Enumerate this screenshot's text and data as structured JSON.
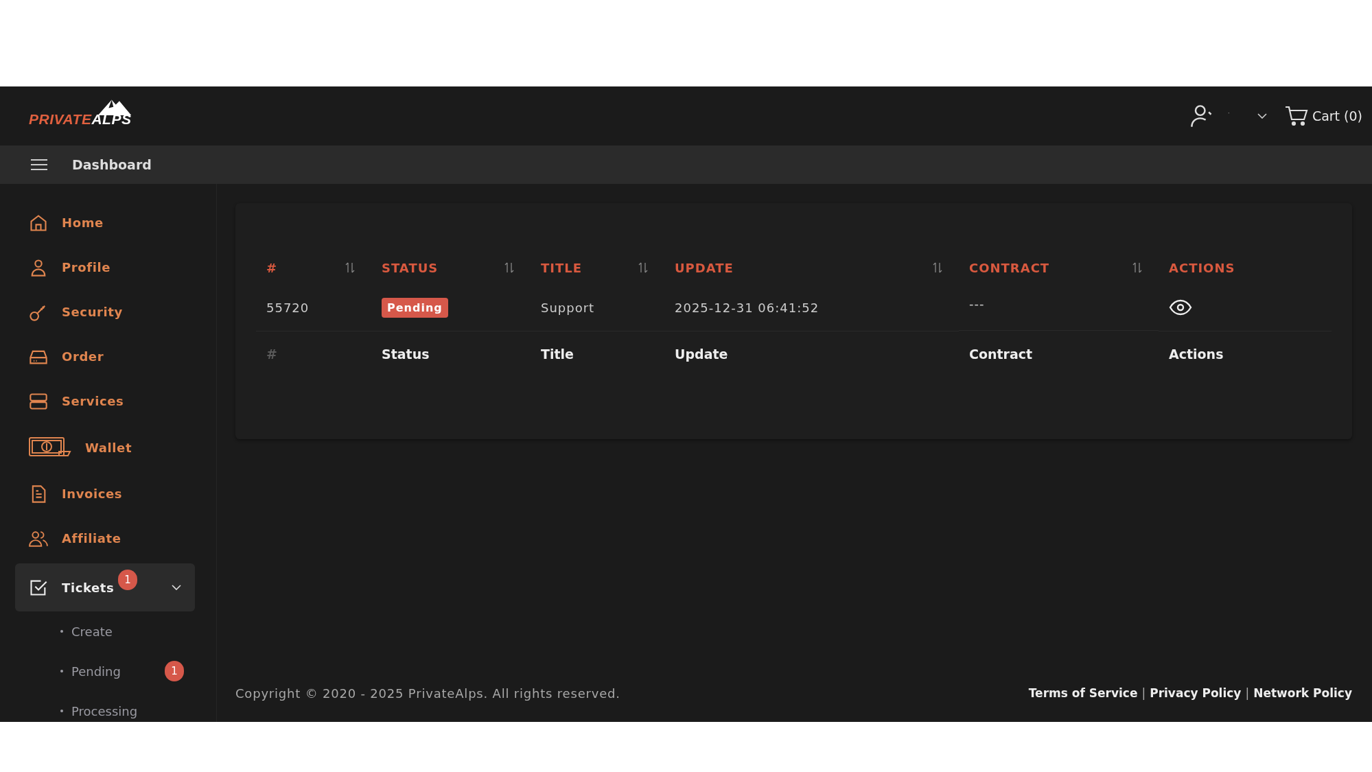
{
  "header": {
    "logo": {
      "part_1": "PRIVATE",
      "part_2": "ALPS"
    },
    "user_name": "·",
    "cart": "Cart (0)"
  },
  "subheader": {
    "title": "Dashboard"
  },
  "sidebar": {
    "items": [
      {
        "label": "Home",
        "selected": false
      },
      {
        "label": "Profile",
        "selected": false
      },
      {
        "label": "Security",
        "selected": false
      },
      {
        "label": "Order",
        "selected": false
      },
      {
        "label": "Services",
        "selected": false
      },
      {
        "label": "Wallet",
        "selected": false
      },
      {
        "label": "Invoices",
        "selected": false
      },
      {
        "label": "Affiliate",
        "selected": false
      },
      {
        "label": "Tickets",
        "selected": true,
        "expanded": true,
        "badge": "1",
        "children": [
          {
            "label": "Create"
          },
          {
            "label": "Pending",
            "badge": "1"
          },
          {
            "label": "Processing"
          }
        ]
      }
    ]
  },
  "table": {
    "columns": [
      {
        "label": "#",
        "sortable": true
      },
      {
        "label": "STATUS",
        "sortable": true
      },
      {
        "label": "TITLE",
        "sortable": true
      },
      {
        "label": "UPDATE",
        "sortable": true
      },
      {
        "label": "CONTRACT",
        "sortable": true
      },
      {
        "label": "ACTIONS",
        "sortable": false
      }
    ],
    "rows": [
      {
        "id": "55720",
        "status": "Pending",
        "title": "Support",
        "update": "2025-12-31 06:41:52",
        "contract": "---"
      }
    ],
    "footer": [
      "#",
      "Status",
      "Title",
      "Update",
      "Contract",
      "Actions"
    ]
  },
  "footer": {
    "copyright": "Copyright © 2020 - 2025 PrivateAlps. All rights reserved.",
    "links": [
      "Terms of Service",
      "Privacy Policy",
      "Network Policy"
    ],
    "separator": "|"
  }
}
